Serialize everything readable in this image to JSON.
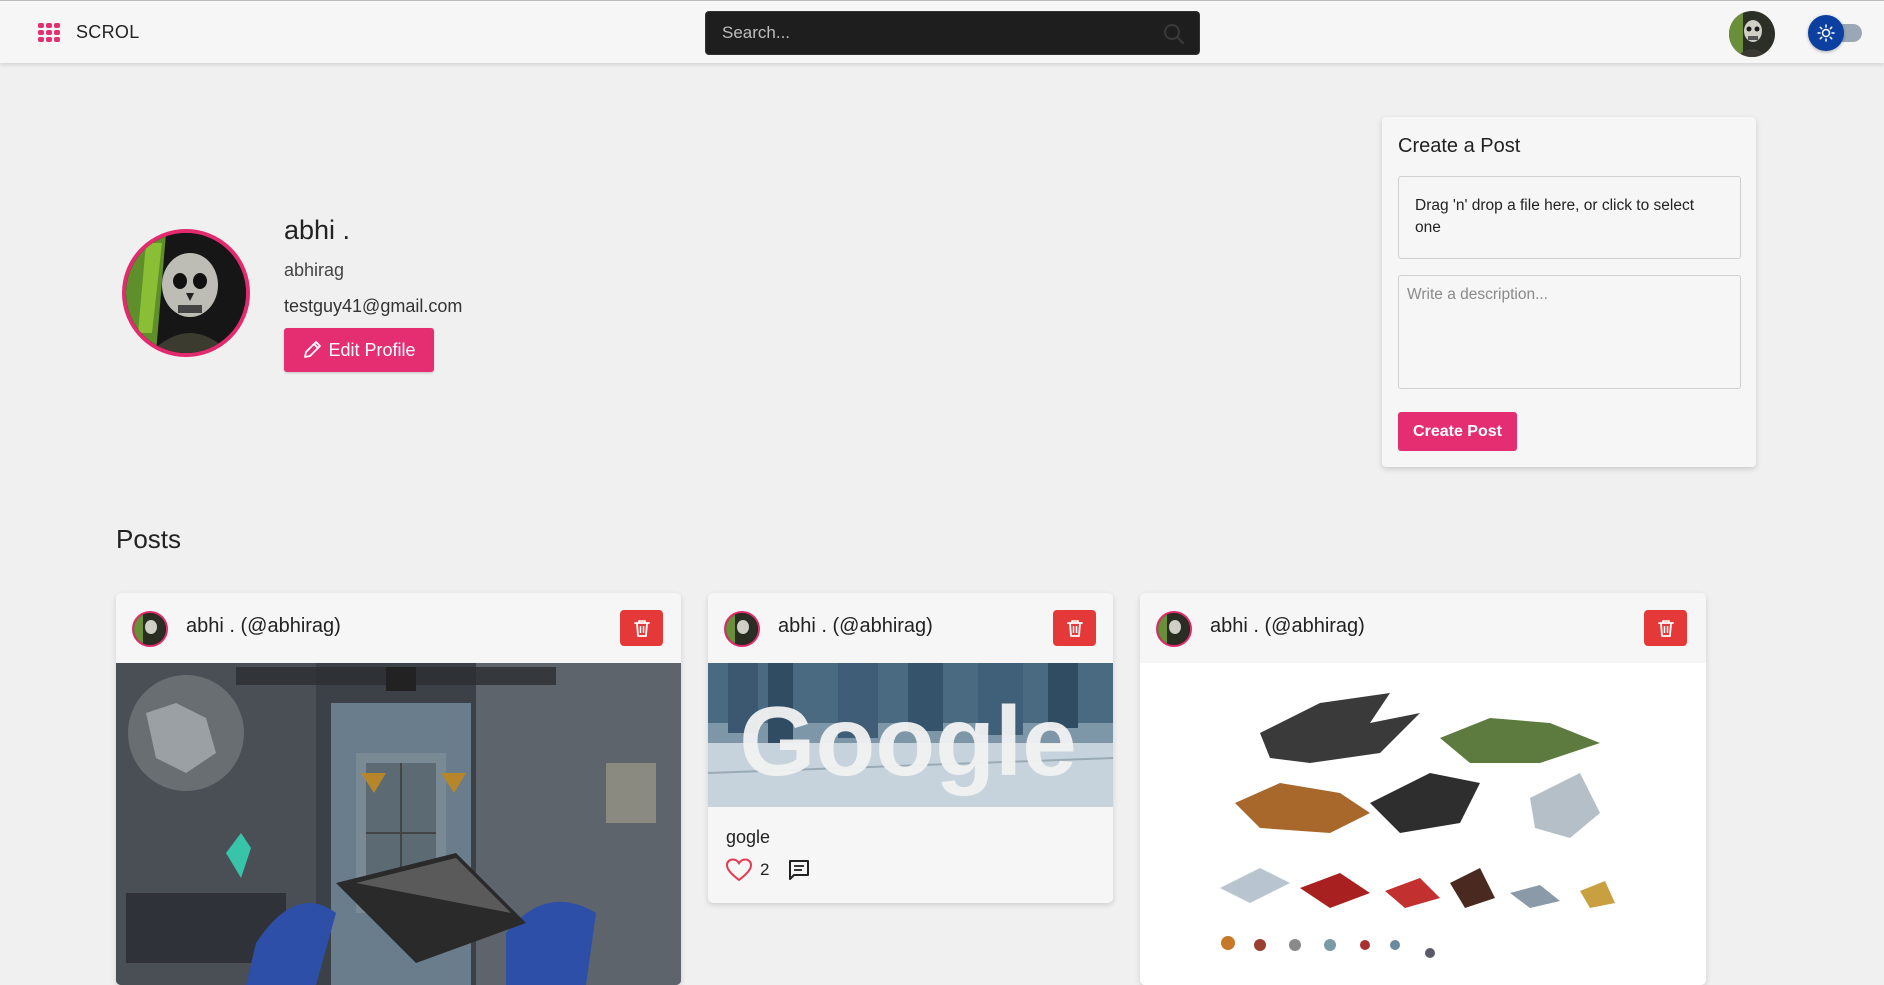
{
  "colors": {
    "accent": "#e52d72",
    "danger": "#e53939",
    "toggle": "#0b3fa0",
    "background": "#f0f0f0"
  },
  "navbar": {
    "brand_name": "SCROL",
    "search_placeholder": "Search..."
  },
  "profile": {
    "name": "abhi .",
    "username": "abhirag",
    "email": "testguy41@gmail.com",
    "edit_label": "Edit Profile"
  },
  "create_post": {
    "title": "Create a Post",
    "dropzone_text": "Drag 'n' drop a file here, or click to select one",
    "description_placeholder": "Write a description...",
    "button_label": "Create Post"
  },
  "posts_title": "Posts",
  "posts": [
    {
      "author": "abhi . (@abhirag)",
      "image_icon": "game-screenshot"
    },
    {
      "author": "abhi . (@abhirag)",
      "image_text": "Google",
      "caption": "gogle",
      "likes": "2",
      "image_icon": "google-banner"
    },
    {
      "author": "abhi . (@abhirag)",
      "image_icon": "dragons-chart"
    }
  ]
}
